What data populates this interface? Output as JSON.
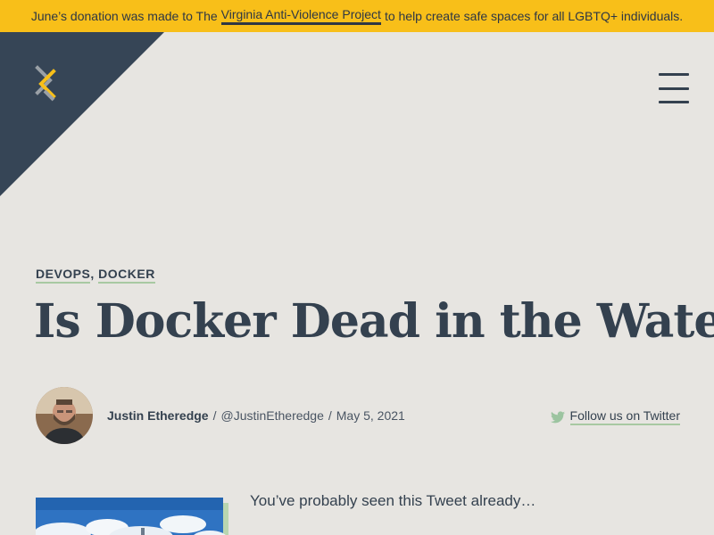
{
  "banner": {
    "before": "June’s donation was made to The",
    "link": "Virginia Anti-Violence Project",
    "after": "to help create safe spaces for all LGBTQ+ individuals."
  },
  "categories": [
    "DEVOPS",
    "DOCKER"
  ],
  "article": {
    "title": "Is Docker Dead in the Water?",
    "author": "Justin Etheredge",
    "handle": "@JustinEtheredge",
    "date": "May 5, 2021",
    "intro": "You’ve probably seen this Tweet already…"
  },
  "social": {
    "follow_label": "Follow us on Twitter"
  },
  "colors": {
    "banner_bg": "#f8bf19",
    "page_bg": "#e7e5e1",
    "corner_bg": "#364556",
    "text": "#34414f",
    "link_underline": "#a8c9a2",
    "logo_yellow": "#f8bf19",
    "logo_gray": "#9aa0a6"
  },
  "icons": {
    "logo": "gray-yellow-chevron-logo",
    "menu": "hamburger-icon",
    "twitter": "twitter-bird-icon"
  }
}
